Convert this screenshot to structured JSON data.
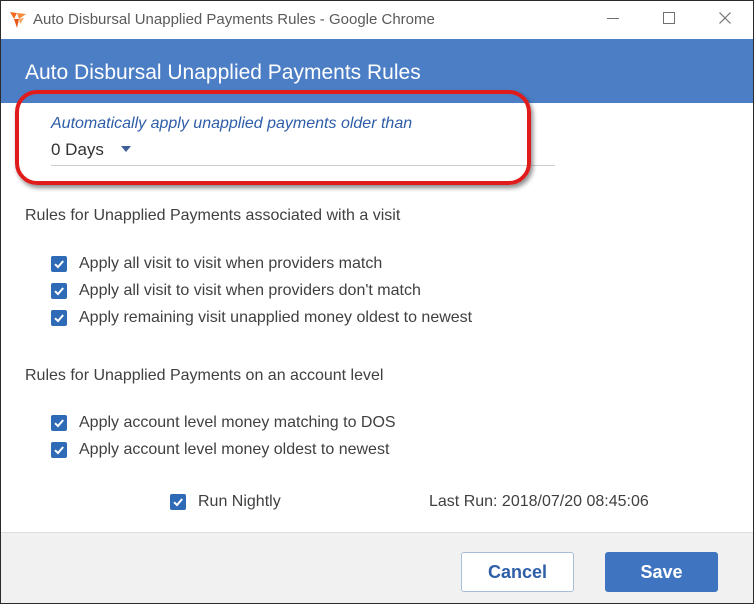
{
  "window": {
    "title": "Auto Disbursal Unapplied Payments Rules - Google Chrome",
    "app_icon": "app-logo-icon",
    "controls": [
      "minimize-icon",
      "maximize-icon",
      "close-icon"
    ]
  },
  "header": {
    "title": "Auto Disbursal Unapplied Payments Rules",
    "color": "#4c7ec6"
  },
  "age_setting": {
    "label": "Automatically apply unapplied payments older than",
    "value": "0 Days",
    "highlight_color": "#e01b1b"
  },
  "visit_rules": {
    "title": "Rules for Unapplied Payments associated with a visit",
    "items": [
      {
        "label": "Apply all visit to visit when providers match",
        "checked": true
      },
      {
        "label": "Apply all visit to visit when providers don't match",
        "checked": true
      },
      {
        "label": "Apply remaining visit unapplied money oldest to newest",
        "checked": true
      }
    ]
  },
  "account_rules": {
    "title": "Rules for Unapplied Payments on an account level",
    "items": [
      {
        "label": "Apply account level money matching to DOS",
        "checked": true
      },
      {
        "label": "Apply account level money oldest to newest",
        "checked": true
      }
    ]
  },
  "schedule": {
    "run_nightly_label": "Run Nightly",
    "run_nightly_checked": true,
    "last_run": "Last Run: 2018/07/20 08:45:06"
  },
  "footer": {
    "cancel_label": "Cancel",
    "save_label": "Save",
    "accent": "#3f74c0"
  }
}
